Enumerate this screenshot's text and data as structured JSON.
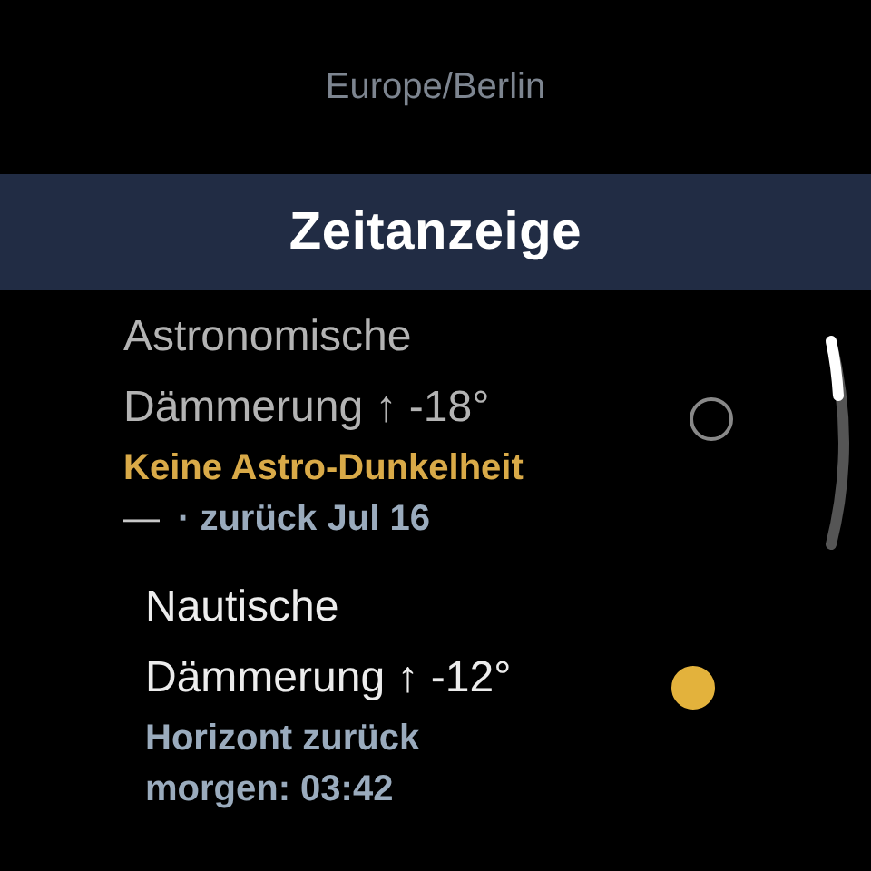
{
  "header": {
    "timezone": "Europe/Berlin"
  },
  "title_bar": {
    "title": "Zeitanzeige"
  },
  "items": [
    {
      "title": "Astronomische Dämmerung ↑ -18°",
      "on": false,
      "status": [
        {
          "kind": "warning",
          "text": "Keine Astro-Dunkelheit"
        },
        {
          "kind": "info",
          "prefix": "—",
          "text": "· zurück Jul 16"
        }
      ]
    },
    {
      "title": "Nautische Dämmerung ↑ -12°",
      "on": true,
      "status": [
        {
          "kind": "info",
          "text": "Horizont zurück morgen: 03:42"
        }
      ]
    }
  ]
}
